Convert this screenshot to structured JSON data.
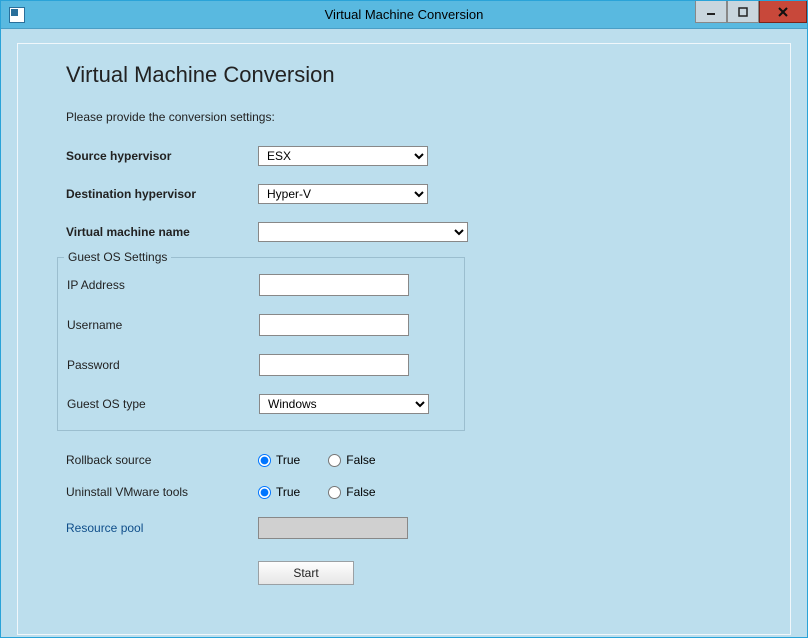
{
  "window": {
    "title": "Virtual Machine Conversion"
  },
  "page": {
    "heading": "Virtual Machine Conversion",
    "instruction": "Please provide the conversion settings:"
  },
  "fields": {
    "source_hypervisor": {
      "label": "Source hypervisor",
      "value": "ESX"
    },
    "destination_hypervisor": {
      "label": "Destination hypervisor",
      "value": "Hyper-V"
    },
    "vm_name": {
      "label": "Virtual machine name",
      "value": ""
    },
    "guest_os_legend": "Guest OS Settings",
    "ip_address": {
      "label": "IP Address",
      "value": ""
    },
    "username": {
      "label": "Username",
      "value": ""
    },
    "password": {
      "label": "Password",
      "value": ""
    },
    "guest_os_type": {
      "label": "Guest OS type",
      "value": "Windows"
    },
    "rollback_source": {
      "label": "Rollback source",
      "true": "True",
      "false": "False",
      "selected": "true"
    },
    "uninstall_vmware": {
      "label": "Uninstall VMware tools",
      "true": "True",
      "false": "False",
      "selected": "true"
    },
    "resource_pool": {
      "label": "Resource pool",
      "value": ""
    }
  },
  "buttons": {
    "start": "Start"
  }
}
